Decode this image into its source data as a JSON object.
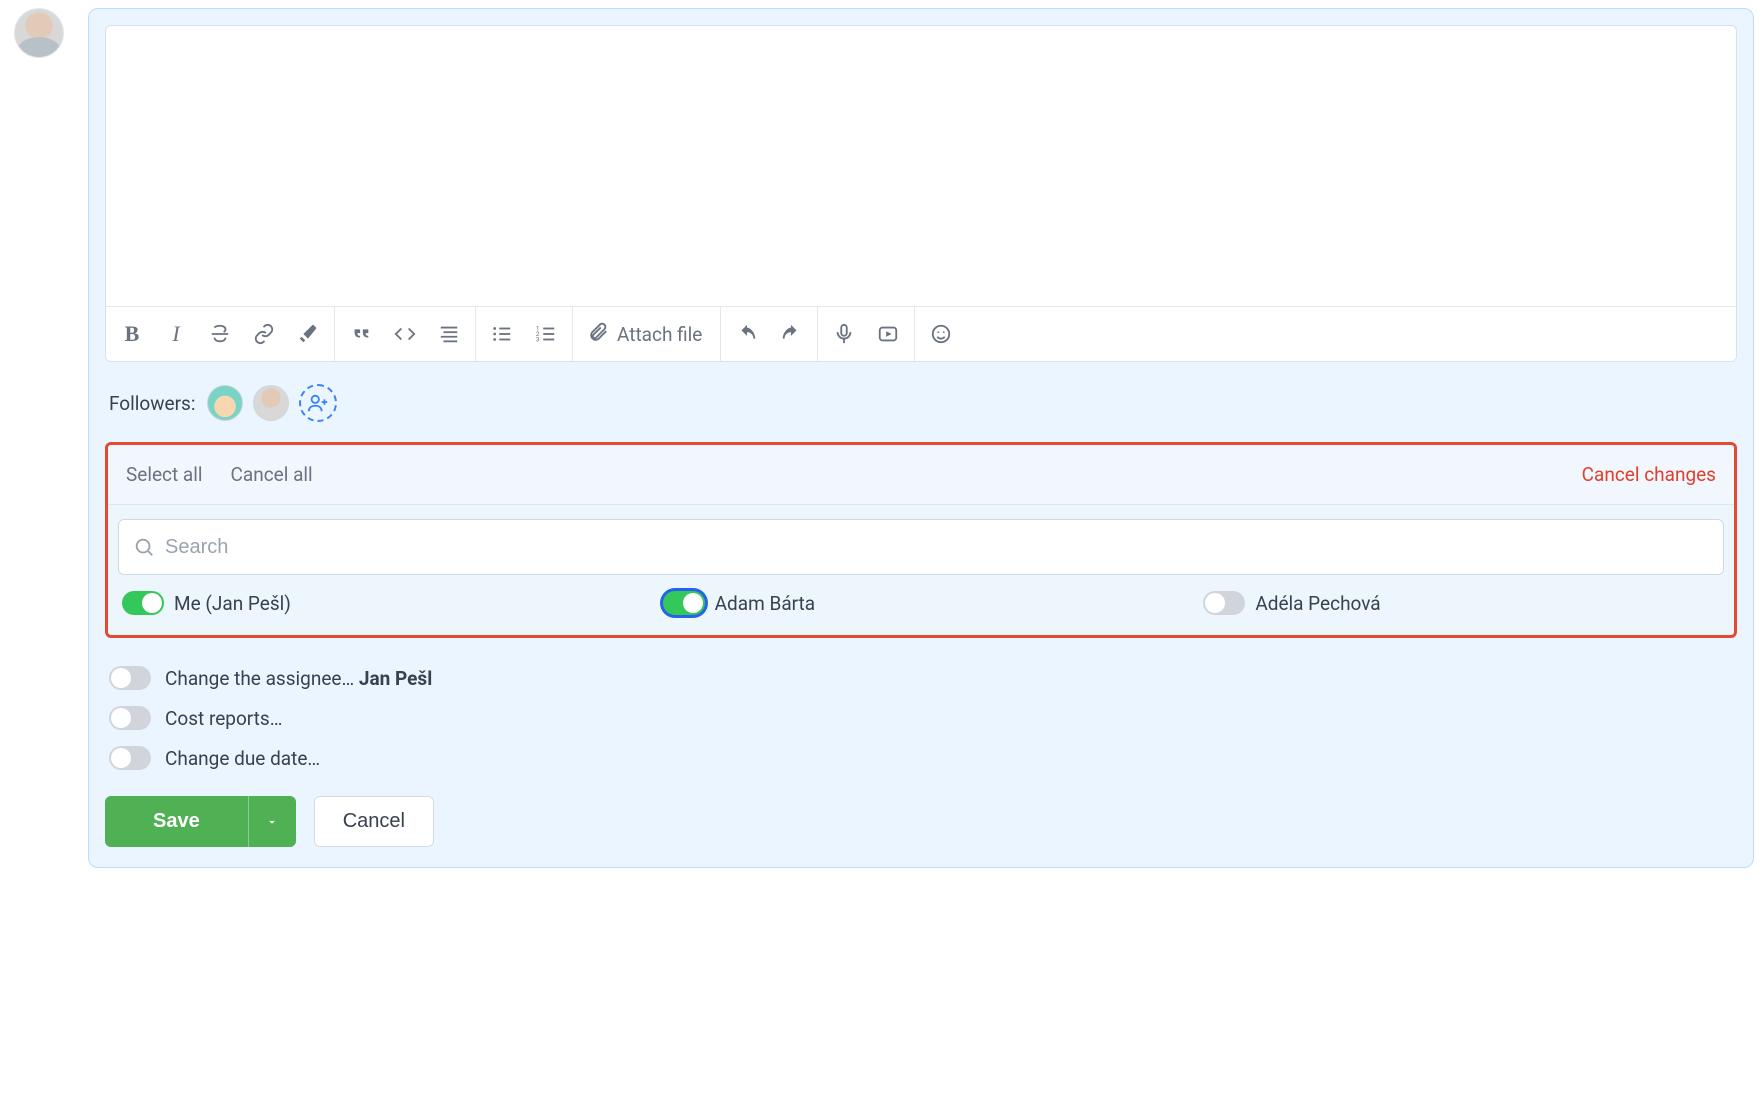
{
  "toolbar": {
    "attach_label": "Attach file"
  },
  "followers": {
    "label": "Followers:"
  },
  "panel": {
    "select_all": "Select all",
    "cancel_all": "Cancel all",
    "cancel_changes": "Cancel changes",
    "search_placeholder": "Search",
    "items": [
      {
        "label": "Me (Jan Pešl)",
        "on": true,
        "ring": false
      },
      {
        "label": "Adam Bárta",
        "on": true,
        "ring": true
      },
      {
        "label": "Adéla Pechová",
        "on": false,
        "ring": false
      }
    ]
  },
  "options": [
    {
      "prefix": "Change the assignee… ",
      "bold": "Jan Pešl",
      "on": false
    },
    {
      "prefix": "Cost reports…",
      "bold": "",
      "on": false
    },
    {
      "prefix": "Change due date…",
      "bold": "",
      "on": false
    }
  ],
  "actions": {
    "save": "Save",
    "cancel": "Cancel"
  }
}
